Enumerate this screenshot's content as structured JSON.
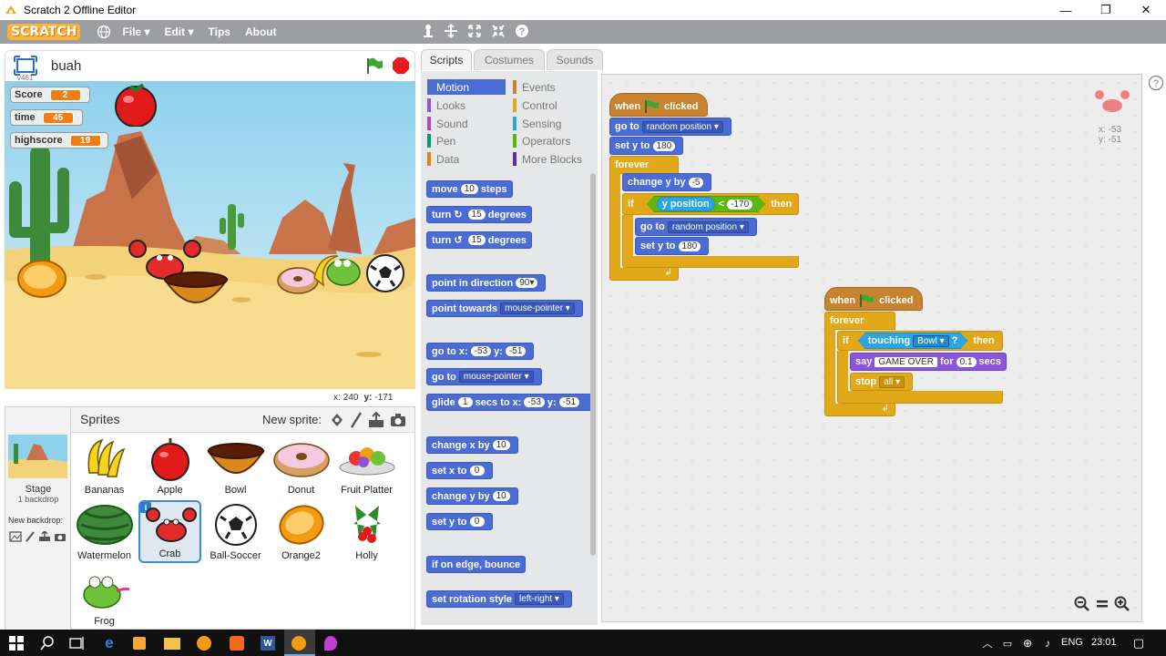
{
  "window": {
    "title": "Scratch 2 Offline Editor",
    "minimize": "—",
    "maximize": "❐",
    "close": "✕"
  },
  "menubar": {
    "logo": "SCRATCH",
    "file": "File ▾",
    "edit": "Edit ▾",
    "tips": "Tips",
    "about": "About"
  },
  "stage": {
    "name": "buah",
    "version": "v461",
    "monitors": [
      {
        "label": "Score",
        "value": "2"
      },
      {
        "label": "time",
        "value": "45"
      },
      {
        "label": "highscore",
        "value": "19"
      }
    ],
    "coords": {
      "x_label": "x:",
      "x": "240",
      "y_label": "y:",
      "y": "-171"
    }
  },
  "sprite_pane": {
    "title": "Sprites",
    "new_sprite": "New sprite:",
    "stage_label": "Stage",
    "stage_backdrops": "1 backdrop",
    "new_backdrop": "New backdrop:",
    "sprites": [
      "Bananas",
      "Apple",
      "Bowl",
      "Donut",
      "Fruit Platter",
      "Watermelon",
      "Crab",
      "Ball-Soccer",
      "Orange2",
      "Holly",
      "Frog"
    ],
    "selected": "Crab"
  },
  "tabs": {
    "scripts": "Scripts",
    "costumes": "Costumes",
    "sounds": "Sounds"
  },
  "categories": {
    "motion": "Motion",
    "looks": "Looks",
    "sound": "Sound",
    "pen": "Pen",
    "data": "Data",
    "events": "Events",
    "control": "Control",
    "sensing": "Sensing",
    "operators": "Operators",
    "more": "More Blocks"
  },
  "palette": {
    "move": "move",
    "move_n": "10",
    "steps": "steps",
    "turn": "turn",
    "turn_n1": "15",
    "turn_n2": "15",
    "degrees": "degrees",
    "point_dir": "point in direction",
    "point_dir_v": "90▾",
    "point_towards": "point towards",
    "point_towards_v": "mouse-pointer ▾",
    "goto_x": "go to x:",
    "goto_xv": "-53",
    "goto_y": "y:",
    "goto_yv": "-51",
    "goto": "go to",
    "goto_v": "mouse-pointer ▾",
    "glide": "glide",
    "glide_n": "1",
    "glide_secs": "secs to x:",
    "glide_x": "-53",
    "glide_y": "y:",
    "glide_yv": "-51",
    "chx": "change x by",
    "chx_n": "10",
    "setx": "set x to",
    "setx_n": "0",
    "chy": "change y by",
    "chy_n": "10",
    "sety": "set y to",
    "sety_n": "0",
    "bounce": "if on edge, bounce",
    "rotstyle": "set rotation style",
    "rotstyle_v": "left-right ▾"
  },
  "script1": {
    "when": "when",
    "clicked": "clicked",
    "goto": "go to",
    "goto_v": "random position ▾",
    "sety": "set y to",
    "sety_v": "180",
    "forever": "forever",
    "chy": "change y by",
    "chy_v": "-5",
    "if": "if",
    "ypos": "y position",
    "lt": "<",
    "lt_v": "-170",
    "then": "then",
    "goto2": "go to",
    "goto2_v": "random position ▾",
    "sety2": "set y to",
    "sety2_v": "180"
  },
  "script2": {
    "when": "when",
    "clicked": "clicked",
    "forever": "forever",
    "if": "if",
    "touching": "touching",
    "touching_v": "Bowl ▾",
    "q": "?",
    "then": "then",
    "say": "say",
    "say_v": "GAME OVER",
    "for": "for",
    "for_v": "0.1",
    "secs": "secs",
    "stop": "stop",
    "stop_v": "all ▾"
  },
  "sprite_info": {
    "x": "x: -53",
    "y": "y: -51"
  },
  "taskbar": {
    "lang": "ENG",
    "time": "23:01"
  }
}
